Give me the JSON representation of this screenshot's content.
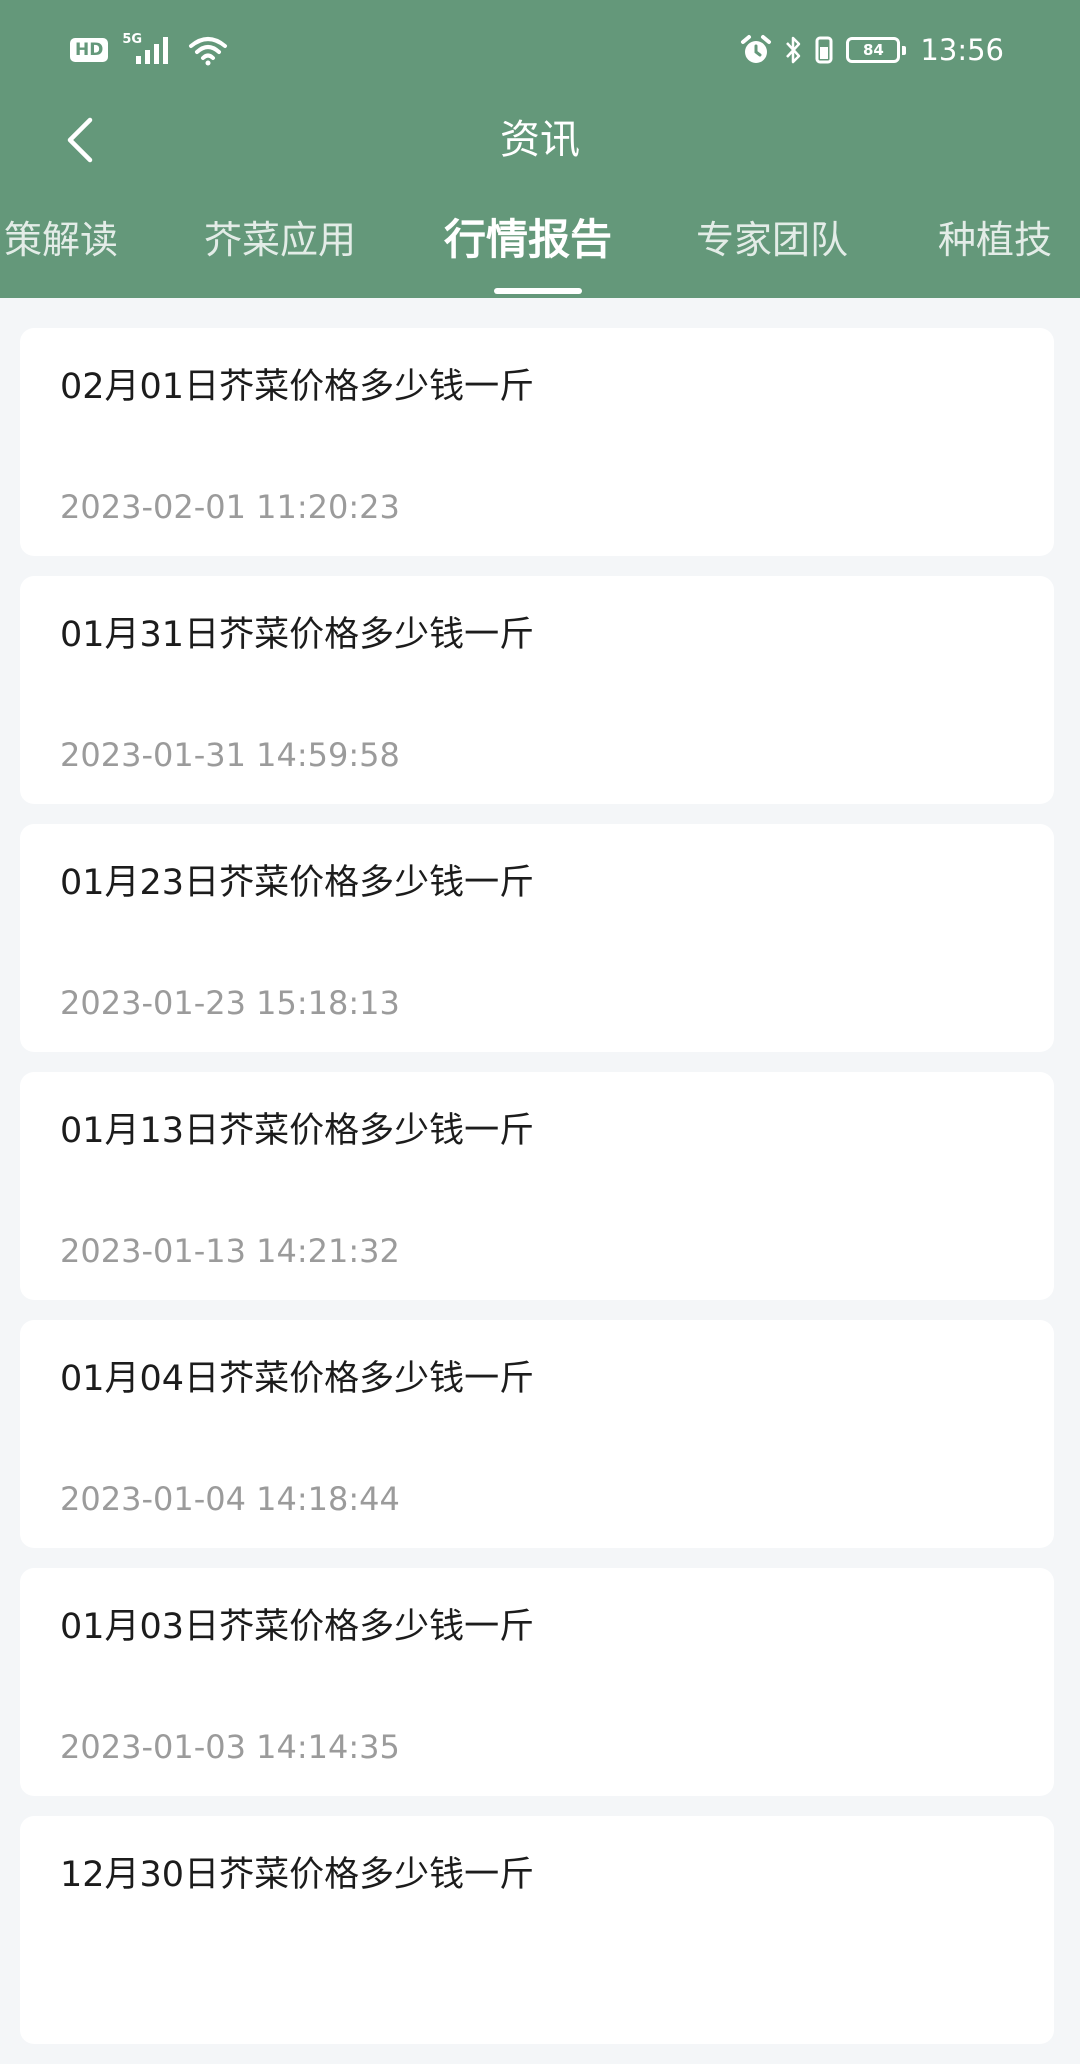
{
  "status_bar": {
    "hd": "HD",
    "network": "5G",
    "battery": "84",
    "time": "13:56"
  },
  "header": {
    "title": "资讯",
    "bg_color": "#64987a"
  },
  "tabs": [
    {
      "label": "策解读",
      "active": false
    },
    {
      "label": "芥菜应用",
      "active": false
    },
    {
      "label": "行情报告",
      "active": true
    },
    {
      "label": "专家团队",
      "active": false
    },
    {
      "label": "种植技",
      "active": false
    }
  ],
  "articles": [
    {
      "title": "02月01日芥菜价格多少钱一斤",
      "time": "2023-02-01 11:20:23"
    },
    {
      "title": "01月31日芥菜价格多少钱一斤",
      "time": "2023-01-31 14:59:58"
    },
    {
      "title": "01月23日芥菜价格多少钱一斤",
      "time": "2023-01-23 15:18:13"
    },
    {
      "title": "01月13日芥菜价格多少钱一斤",
      "time": "2023-01-13 14:21:32"
    },
    {
      "title": "01月04日芥菜价格多少钱一斤",
      "time": "2023-01-04 14:18:44"
    },
    {
      "title": "01月03日芥菜价格多少钱一斤",
      "time": "2023-01-03 14:14:35"
    },
    {
      "title": "12月30日芥菜价格多少钱一斤",
      "time": ""
    }
  ]
}
